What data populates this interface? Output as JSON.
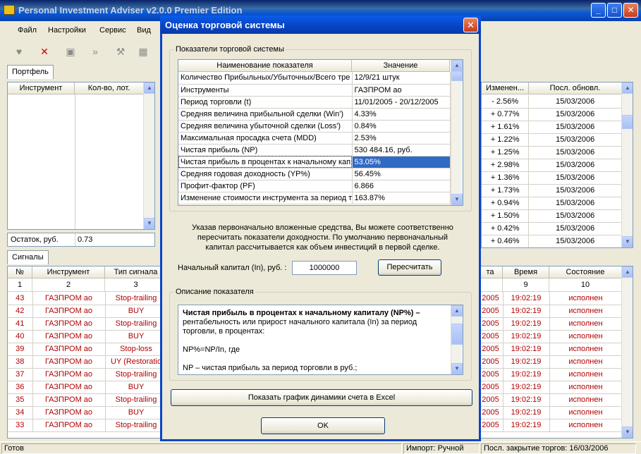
{
  "app": {
    "title": "Personal Investment Adviser v2.0.0 Premier Edition"
  },
  "menu": [
    "Файл",
    "Настройки",
    "Сервис",
    "Вид"
  ],
  "portfolio": {
    "tab": "Портфель",
    "headers": [
      "Инструмент",
      "Кол-во, лот."
    ],
    "balance_label": "Остаток, руб.",
    "balance_value": "0.73"
  },
  "quotes": {
    "headers": [
      "Изменен...",
      "Посл. обновл."
    ],
    "rows": [
      [
        "- 2.56%",
        "15/03/2006"
      ],
      [
        "+ 0.77%",
        "15/03/2006"
      ],
      [
        "+ 1.61%",
        "15/03/2006"
      ],
      [
        "+ 1.22%",
        "15/03/2006"
      ],
      [
        "+ 1.25%",
        "15/03/2006"
      ],
      [
        "+ 2.98%",
        "15/03/2006"
      ],
      [
        "+ 1.36%",
        "15/03/2006"
      ],
      [
        "+ 1.73%",
        "15/03/2006"
      ],
      [
        "+ 0.94%",
        "15/03/2006"
      ],
      [
        "+ 1.50%",
        "15/03/2006"
      ],
      [
        "+ 0.42%",
        "15/03/2006"
      ],
      [
        "+ 0.46%",
        "15/03/2006"
      ]
    ]
  },
  "signals": {
    "tab": "Сигналы",
    "headers": [
      "№",
      "Инструмент",
      "Тип сигнала",
      "та",
      "Время",
      "Состояние"
    ],
    "numbers": [
      "1",
      "2",
      "3",
      "",
      "9",
      "10"
    ],
    "rows": [
      [
        "43",
        "ГАЗПРОМ ао",
        "Stop-trailing",
        "2005",
        "19:02:19",
        "исполнен"
      ],
      [
        "42",
        "ГАЗПРОМ ао",
        "BUY",
        "2005",
        "19:02:19",
        "исполнен"
      ],
      [
        "41",
        "ГАЗПРОМ ао",
        "Stop-trailing",
        "2005",
        "19:02:19",
        "исполнен"
      ],
      [
        "40",
        "ГАЗПРОМ ао",
        "BUY",
        "2005",
        "19:02:19",
        "исполнен"
      ],
      [
        "39",
        "ГАЗПРОМ ао",
        "Stop-loss",
        "2005",
        "19:02:19",
        "исполнен"
      ],
      [
        "38",
        "ГАЗПРОМ ао",
        "UY (Restoratio",
        "2005",
        "19:02:19",
        "исполнен"
      ],
      [
        "37",
        "ГАЗПРОМ ао",
        "Stop-trailing",
        "2005",
        "19:02:19",
        "исполнен"
      ],
      [
        "36",
        "ГАЗПРОМ ао",
        "BUY",
        "2005",
        "19:02:19",
        "исполнен"
      ],
      [
        "35",
        "ГАЗПРОМ ао",
        "Stop-trailing",
        "2005",
        "19:02:19",
        "исполнен"
      ],
      [
        "34",
        "ГАЗПРОМ ао",
        "BUY",
        "2005",
        "19:02:19",
        "исполнен"
      ],
      [
        "33",
        "ГАЗПРОМ ао",
        "Stop-trailing",
        "2005",
        "19:02:19",
        "исполнен"
      ]
    ]
  },
  "status": {
    "ready": "Готов",
    "import": "Импорт: Ручной",
    "last_close": "Посл. закрытие торгов:  16/03/2006"
  },
  "dialog": {
    "title": "Оценка торговой системы",
    "group1": "Показатели торговой системы",
    "headers": [
      "Наименование показателя",
      "Значение"
    ],
    "rows": [
      [
        "Количество Прибыльных/Убыточных/Всего тре",
        "12/9/21 штук"
      ],
      [
        "Инструменты",
        "ГАЗПРОМ ао"
      ],
      [
        "Период торговли (t)",
        "11/01/2005 - 20/12/2005"
      ],
      [
        "Средняя величина прибыльной сделки (Win')",
        "4.33%"
      ],
      [
        "Средняя величина убыточной сделки (Loss')",
        "0.84%"
      ],
      [
        "Максимальная просадка счета (MDD)",
        "2.53%"
      ],
      [
        "Чистая прибыль (NP)",
        "530 484.16, руб."
      ],
      [
        "Чистая прибыль в процентах к начальному кап",
        "53.05%"
      ],
      [
        "Средняя годовая доходность (YP%)",
        "56.45%"
      ],
      [
        "Профит-фактор (PF)",
        "6.866"
      ],
      [
        "Изменение стоимости инструмента за период т",
        "163.87%"
      ]
    ],
    "selected_index": 7,
    "info_text": "Указав первоначально вложенные средства, Вы можете соответственно пересчитать показатели доходности. По умолчанию первоначальный капитал рассчитывается как объем инвестиций в первой сделке.",
    "capital_label": "Начальный капитал (In), руб. :",
    "capital_value": "1000000",
    "recalc_button": "Пересчитать",
    "group2": "Описание показателя",
    "desc_title": "Чистая прибыль в процентах к начальному капиталу (NP%)",
    "desc_dash": " –",
    "desc_body": "рентабельность или прирост начального капитала (In) за период торговли, в процентах:",
    "desc_formula": "NP%=NP/In, где",
    "desc_np": "NP – чистая прибыль за период торговли в руб.;",
    "excel_button": "Показать график динамики счета в Excel",
    "ok_button": "OK"
  }
}
